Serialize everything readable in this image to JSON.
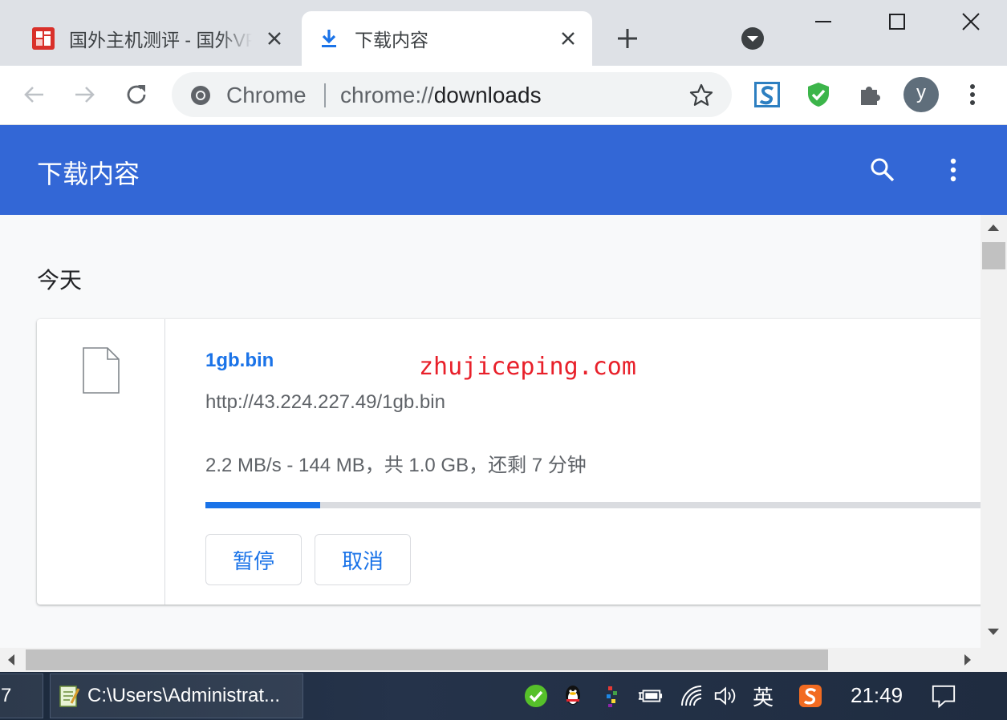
{
  "tabs": [
    {
      "title": "国外主机测评 - 国外VPS",
      "active": false
    },
    {
      "title": "下载内容",
      "active": true
    }
  ],
  "omnibox": {
    "origin": "Chrome",
    "url_scheme": "chrome://",
    "url_host": "downloads"
  },
  "profile": {
    "initial": "y"
  },
  "page": {
    "title": "下载内容",
    "section": "今天"
  },
  "download": {
    "file_name": "1gb.bin",
    "url": "http://43.224.227.49/1gb.bin",
    "watermark": "zhujiceping.com",
    "status": "2.2 MB/s - 144 MB，共 1.0 GB，还剩 7 分钟",
    "progress": 0.144,
    "pause_label": "暂停",
    "cancel_label": "取消"
  },
  "taskbar": {
    "partial_item": "7",
    "window_item": "C:\\Users\\Administrat...",
    "ime": "英",
    "clock": "21:49"
  },
  "colors": {
    "accent": "#3367d6",
    "link": "#1a73e8",
    "watermark": "#e8202a"
  },
  "icons": [
    "favicon-icon",
    "download-icon",
    "close-icon",
    "plus-icon",
    "tab-search-icon",
    "minimize-icon",
    "maximize-icon",
    "back-arrow-icon",
    "forward-arrow-icon",
    "reload-icon",
    "chrome-icon",
    "star-icon",
    "extension-s-icon",
    "shield-check-icon",
    "puzzle-icon",
    "kebab-menu-icon",
    "search-icon",
    "file-icon",
    "notification-icon"
  ]
}
